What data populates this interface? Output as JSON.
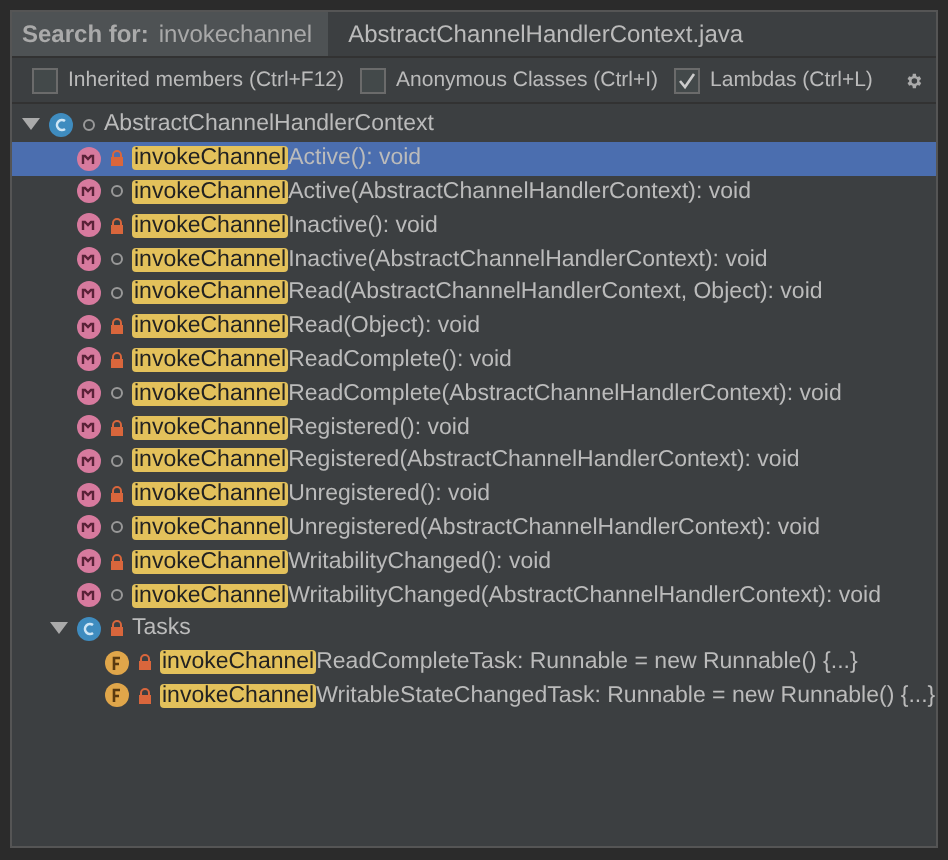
{
  "search": {
    "label": "Search for:",
    "value": "invokechannel",
    "file": "AbstractChannelHandlerContext.java"
  },
  "options": [
    {
      "label": "Inherited members (Ctrl+F12)",
      "checked": false
    },
    {
      "label": "Anonymous Classes (Ctrl+I)",
      "checked": false
    },
    {
      "label": "Lambdas (Ctrl+L)",
      "checked": true
    }
  ],
  "tree": [
    {
      "kind": "class",
      "locked": false,
      "name": "AbstractChannelHandlerContext",
      "expanded": true,
      "selected": false,
      "children": [
        {
          "kind": "method",
          "locked": true,
          "match": "invokeChannel",
          "rest": "Active(): void",
          "selected": true
        },
        {
          "kind": "method",
          "locked": false,
          "match": "invokeChannel",
          "rest": "Active(AbstractChannelHandlerContext): void",
          "selected": false
        },
        {
          "kind": "method",
          "locked": true,
          "match": "invokeChannel",
          "rest": "Inactive(): void",
          "selected": false
        },
        {
          "kind": "method",
          "locked": false,
          "match": "invokeChannel",
          "rest": "Inactive(AbstractChannelHandlerContext): void",
          "selected": false
        },
        {
          "kind": "method",
          "locked": false,
          "match": "invokeChannel",
          "rest": "Read(AbstractChannelHandlerContext, Object): void",
          "selected": false
        },
        {
          "kind": "method",
          "locked": true,
          "match": "invokeChannel",
          "rest": "Read(Object): void",
          "selected": false
        },
        {
          "kind": "method",
          "locked": true,
          "match": "invokeChannel",
          "rest": "ReadComplete(): void",
          "selected": false
        },
        {
          "kind": "method",
          "locked": false,
          "match": "invokeChannel",
          "rest": "ReadComplete(AbstractChannelHandlerContext): void",
          "selected": false
        },
        {
          "kind": "method",
          "locked": true,
          "match": "invokeChannel",
          "rest": "Registered(): void",
          "selected": false
        },
        {
          "kind": "method",
          "locked": false,
          "match": "invokeChannel",
          "rest": "Registered(AbstractChannelHandlerContext): void",
          "selected": false
        },
        {
          "kind": "method",
          "locked": true,
          "match": "invokeChannel",
          "rest": "Unregistered(): void",
          "selected": false
        },
        {
          "kind": "method",
          "locked": false,
          "match": "invokeChannel",
          "rest": "Unregistered(AbstractChannelHandlerContext): void",
          "selected": false
        },
        {
          "kind": "method",
          "locked": true,
          "match": "invokeChannel",
          "rest": "WritabilityChanged(): void",
          "selected": false
        },
        {
          "kind": "method",
          "locked": false,
          "match": "invokeChannel",
          "rest": "WritabilityChanged(AbstractChannelHandlerContext): void",
          "selected": false
        },
        {
          "kind": "class",
          "locked": true,
          "name": "Tasks",
          "expanded": true,
          "selected": false,
          "children": [
            {
              "kind": "field",
              "locked": true,
              "match": "invokeChannel",
              "rest": "ReadCompleteTask: Runnable = new Runnable() {...}",
              "selected": false
            },
            {
              "kind": "field",
              "locked": true,
              "match": "invokeChannel",
              "rest": "WritableStateChangedTask: Runnable = new Runnable() {...}",
              "selected": false
            }
          ]
        }
      ]
    }
  ]
}
